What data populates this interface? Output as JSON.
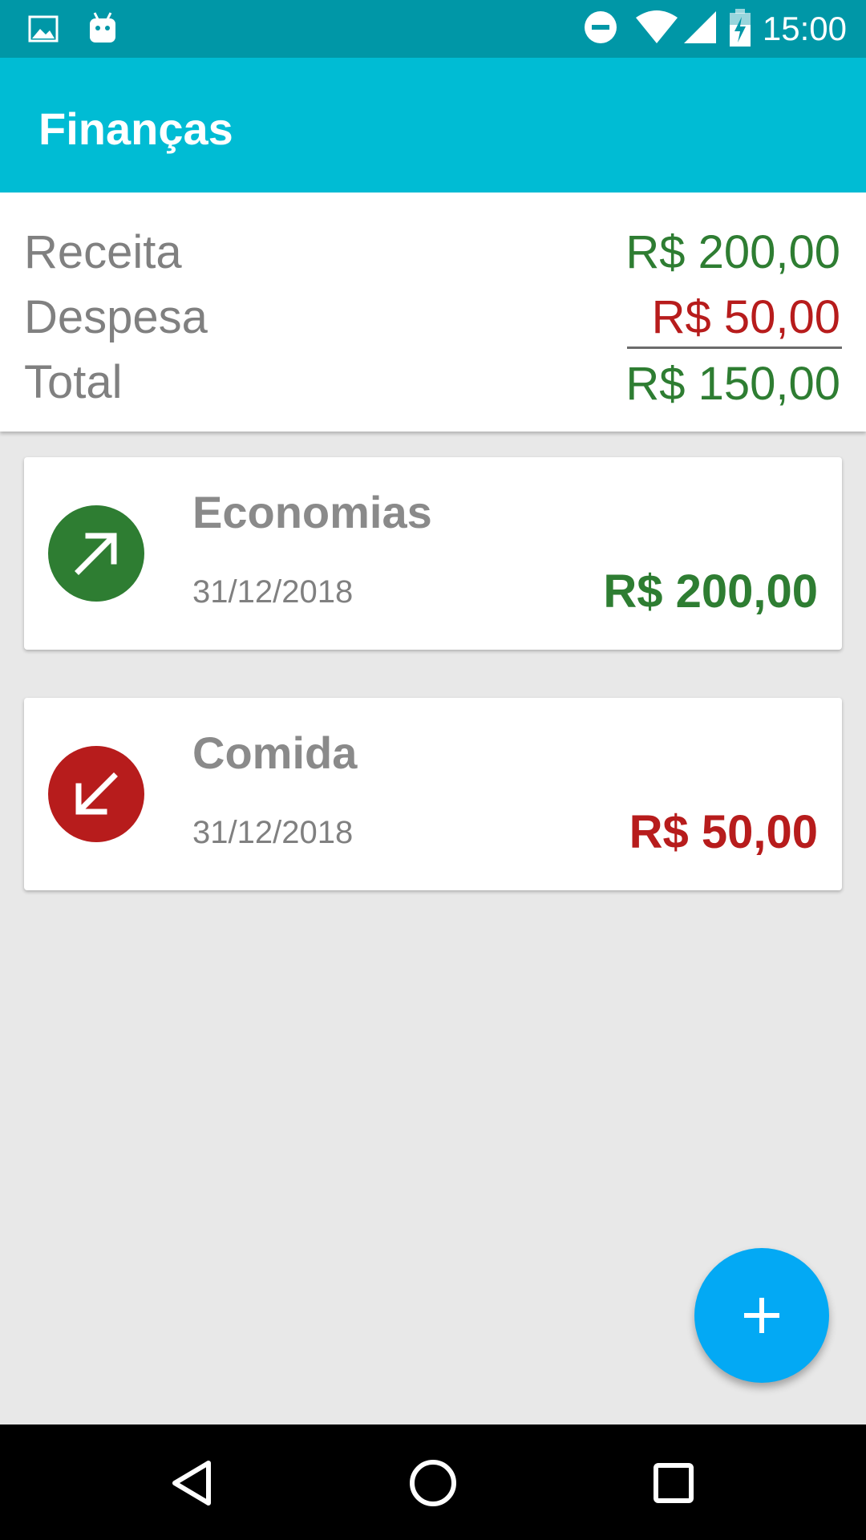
{
  "status_bar": {
    "time": "15:00",
    "icons": [
      "image-icon",
      "android-icon",
      "do-not-disturb-icon",
      "wifi-icon",
      "signal-icon",
      "battery-charging-icon"
    ]
  },
  "app_bar": {
    "title": "Finanças"
  },
  "summary": {
    "income_label": "Receita",
    "income_value": "R$ 200,00",
    "expense_label": "Despesa",
    "expense_value": "R$ 50,00",
    "total_label": "Total",
    "total_value": "R$ 150,00"
  },
  "transactions": [
    {
      "title": "Economias",
      "date": "31/12/2018",
      "amount": "R$ 200,00",
      "type": "income",
      "icon": "arrow-up-right-icon",
      "color": "#2e7d32"
    },
    {
      "title": "Comida",
      "date": "31/12/2018",
      "amount": "R$ 50,00",
      "type": "expense",
      "icon": "arrow-down-left-icon",
      "color": "#b71c1c"
    }
  ],
  "fab": {
    "icon": "plus-icon"
  },
  "nav_bar": {
    "icons": [
      "back-icon",
      "home-icon",
      "recents-icon"
    ]
  },
  "colors": {
    "primary": "#00bcd4",
    "primary_dark": "#0097a7",
    "accent": "#03a9f4",
    "income": "#2e7d32",
    "expense": "#b71c1c"
  }
}
